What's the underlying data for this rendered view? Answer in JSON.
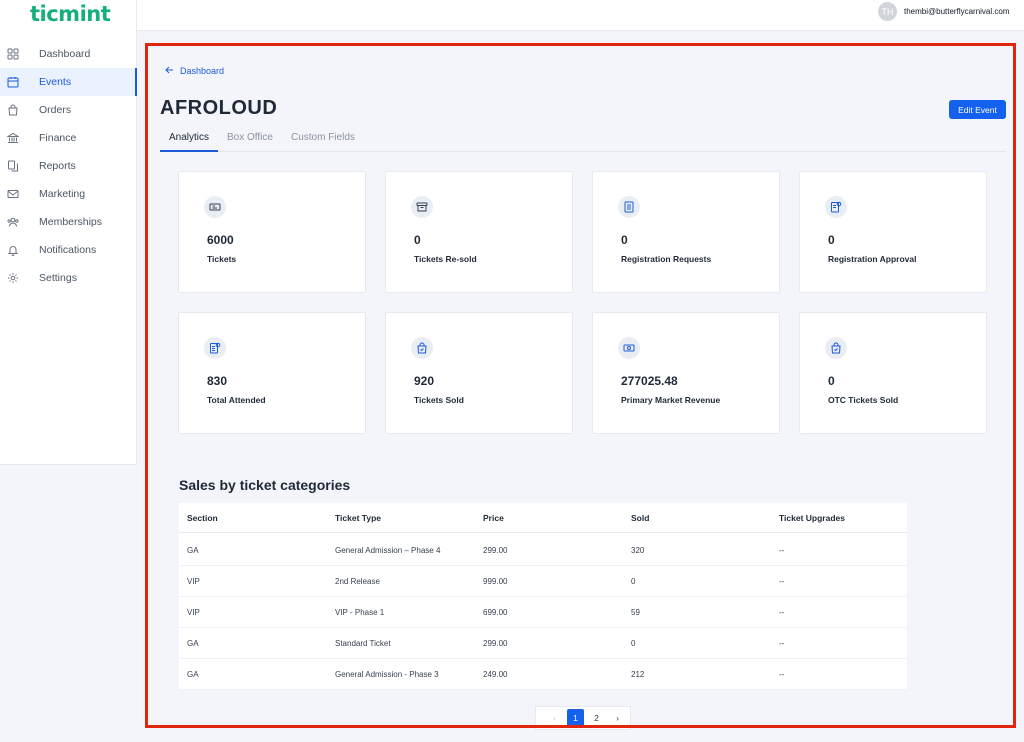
{
  "app": {
    "logo": "ticmint"
  },
  "user": {
    "initials": "TH",
    "email": "thembi@butterflycarnival.com"
  },
  "sidebar": {
    "items": [
      {
        "label": "Dashboard",
        "icon": "grid-icon",
        "active": false
      },
      {
        "label": "Events",
        "icon": "calendar-icon",
        "active": true
      },
      {
        "label": "Orders",
        "icon": "shopping-bag-icon",
        "active": false
      },
      {
        "label": "Finance",
        "icon": "bank-icon",
        "active": false
      },
      {
        "label": "Reports",
        "icon": "documents-icon",
        "active": false
      },
      {
        "label": "Marketing",
        "icon": "mail-icon",
        "active": false
      },
      {
        "label": "Memberships",
        "icon": "users-icon",
        "active": false
      },
      {
        "label": "Notifications",
        "icon": "bell-icon",
        "active": false
      },
      {
        "label": "Settings",
        "icon": "gear-icon",
        "active": false
      }
    ]
  },
  "header": {
    "back_label": "Dashboard",
    "title": "AFROLOUD",
    "edit_label": "Edit Event"
  },
  "tabs": [
    {
      "label": "Analytics",
      "active": true
    },
    {
      "label": "Box Office",
      "active": false
    },
    {
      "label": "Custom Fields",
      "active": false
    }
  ],
  "stats": [
    {
      "value": "6000",
      "label": "Tickets",
      "icon": "ticket-icon"
    },
    {
      "value": "0",
      "label": "Tickets Re-sold",
      "icon": "archive-box-icon"
    },
    {
      "value": "0",
      "label": "Registration Requests",
      "icon": "clipboard-list-icon"
    },
    {
      "value": "0",
      "label": "Registration Approval",
      "icon": "clipboard-check-icon"
    },
    {
      "value": "830",
      "label": "Total Attended",
      "icon": "clipboard-user-icon"
    },
    {
      "value": "920",
      "label": "Tickets Sold",
      "icon": "bag-icon"
    },
    {
      "value": "277025.48",
      "label": "Primary Market Revenue",
      "icon": "cash-icon"
    },
    {
      "value": "0",
      "label": "OTC Tickets Sold",
      "icon": "bag-icon"
    }
  ],
  "sales": {
    "title": "Sales by ticket categories",
    "columns": [
      "Section",
      "Ticket Type",
      "Price",
      "Sold",
      "Ticket Upgrades"
    ],
    "rows": [
      [
        "GA",
        "General Admission – Phase 4",
        "299.00",
        "320",
        "--"
      ],
      [
        "VIP",
        "2nd Release",
        "999.00",
        "0",
        "--"
      ],
      [
        "VIP",
        "VIP - Phase 1",
        "699.00",
        "59",
        "--"
      ],
      [
        "GA",
        "Standard Ticket",
        "299.00",
        "0",
        "--"
      ],
      [
        "GA",
        "General Admission - Phase 3",
        "249.00",
        "212",
        "--"
      ]
    ]
  },
  "pagination": {
    "prev": "‹",
    "pages": [
      "1",
      "2"
    ],
    "current": "1",
    "next": "›"
  },
  "colors": {
    "accent": "#1361ee",
    "brand": "#15b07a",
    "highlight_frame": "#e0260c"
  }
}
